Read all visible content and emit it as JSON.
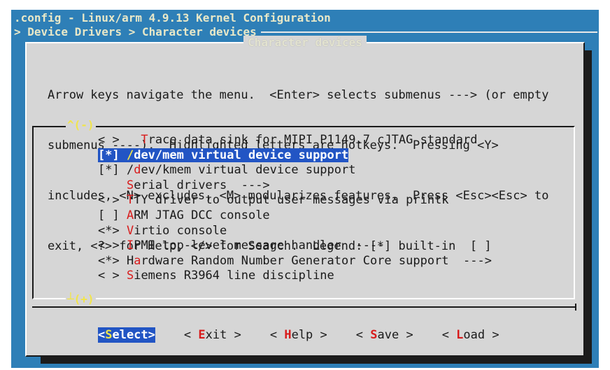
{
  "window": {
    "title": ".config - Linux/arm 4.9.13 Kernel Configuration",
    "breadcrumb": "> Device Drivers > Character devices"
  },
  "dialog": {
    "title": "Character devices",
    "help_lines": [
      "Arrow keys navigate the menu.  <Enter> selects submenus ---> (or empty",
      "submenus ----).  Highlighted letters are hotkeys.  Pressing <Y>",
      "includes, <N> excludes, <M> modularizes features.  Press <Esc><Esc> to",
      "exit, <?> for Help, </> for Search.  Legend: [*] built-in  [ ]"
    ]
  },
  "menu": {
    "scroll_up": "^(-)",
    "scroll_down": "┴(+)",
    "items": [
      {
        "prefix": "< >   ",
        "hotkey": "T",
        "rest": "race data sink for MIPI P1149.7 cJTAG standard"
      },
      {
        "prefix": "[*] ",
        "hotkey": "/",
        "rest": "dev/mem virtual device support",
        "selected": true
      },
      {
        "prefix": "[*] /",
        "hotkey": "d",
        "rest": "ev/kmem virtual device support"
      },
      {
        "prefix": "    ",
        "hotkey": "S",
        "rest": "erial drivers  --->"
      },
      {
        "prefix": "< > ",
        "hotkey": "T",
        "rest": "TY driver to output user messages via printk"
      },
      {
        "prefix": "[ ] ",
        "hotkey": "A",
        "rest": "RM JTAG DCC console"
      },
      {
        "prefix": "<*> ",
        "hotkey": "V",
        "rest": "irtio console"
      },
      {
        "prefix": "< > ",
        "hotkey": "I",
        "rest": "PMI top-level message handler  ----"
      },
      {
        "prefix": "<*> H",
        "hotkey": "a",
        "rest": "rdware Random Number Generator Core support  --->"
      },
      {
        "prefix": "< > ",
        "hotkey": "S",
        "rest": "iemens R3964 line discipline"
      }
    ]
  },
  "buttons": [
    {
      "pre": "<",
      "hotkey": "S",
      "post": "elect>",
      "selected": true
    },
    {
      "pre": "< ",
      "hotkey": "E",
      "post": "xit >"
    },
    {
      "pre": "< ",
      "hotkey": "H",
      "post": "elp >"
    },
    {
      "pre": "< ",
      "hotkey": "S",
      "post": "ave >"
    },
    {
      "pre": "< ",
      "hotkey": "L",
      "post": "oad >"
    }
  ],
  "colors": {
    "background": "#2e7fb7",
    "dialog": "#d6d6d6",
    "highlight": "#2255c4",
    "hotkey": "#d81b1b",
    "selected_hotkey": "#f0e44a"
  }
}
